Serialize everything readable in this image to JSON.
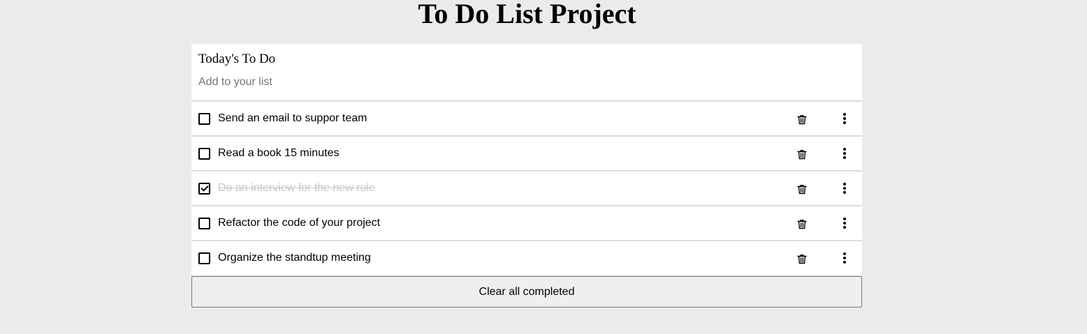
{
  "page": {
    "title": "To Do List Project"
  },
  "list": {
    "title": "Today's To Do",
    "input_value": "",
    "input_placeholder": "Add to your list"
  },
  "todos": [
    {
      "text": "Send an email to suppor team",
      "completed": false
    },
    {
      "text": "Read a book 15 minutes",
      "completed": false
    },
    {
      "text": "Do an interview for the new role",
      "completed": true
    },
    {
      "text": "Refactor the code of your project",
      "completed": false
    },
    {
      "text": "Organize the standtup meeting",
      "completed": false
    }
  ],
  "icons": {
    "delete": "trash-icon",
    "more": "more-vertical-icon"
  },
  "footer": {
    "clear_label": "Clear all completed"
  },
  "colors": {
    "background": "#ebebeb",
    "card": "#ffffff",
    "completed_text": "#c7c7c7",
    "divider": "#dcdcdc"
  }
}
